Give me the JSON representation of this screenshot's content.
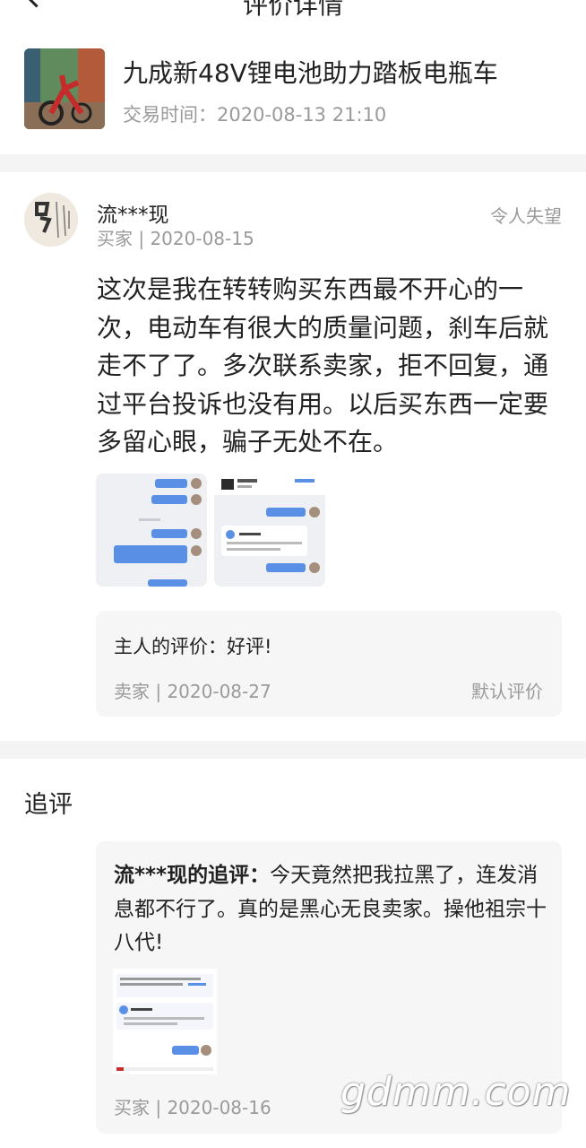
{
  "header": {
    "title": "评价详情"
  },
  "product": {
    "title": "九成新48V锂电池助力踏板电瓶车",
    "time_label": "交易时间：2020-08-13 21:10"
  },
  "review": {
    "reviewer": "流***现",
    "meta": "买家 | 2020-08-15",
    "rating": "令人失望",
    "text": "这次是我在转转购买东西最不开心的一次，电动车有很大的质量问题，刹车后就走不了了。多次联系卖家，拒不回复，通过平台投诉也没有用。以后买东西一定要多留心眼，骗子无处不在。"
  },
  "seller_reply": {
    "title": "主人的评价：好评!",
    "meta": "卖家 | 2020-08-27",
    "tag": "默认评价"
  },
  "followup": {
    "section_title": "追评",
    "name": "流***现的追评：",
    "text": "今天竟然把我拉黑了，连发消息都不行了。真的是黑心无良卖家。操他祖宗十八代!",
    "meta": "买家 | 2020-08-16"
  },
  "watermark": "gdmm.com",
  "colors": {
    "accent": "#5a8fe6",
    "muted": "#9a9a9a",
    "box": "#f6f6f6"
  }
}
